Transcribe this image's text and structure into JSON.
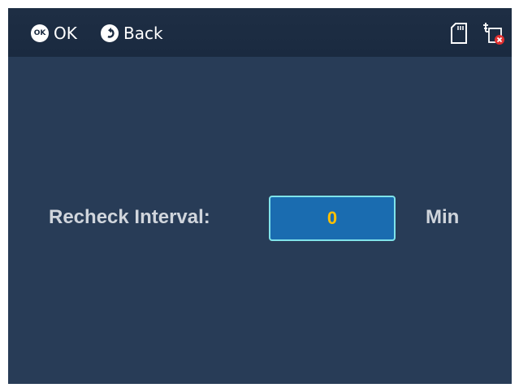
{
  "topbar": {
    "ok_icon_text": "OK",
    "ok_label": "OK",
    "back_label": "Back",
    "icons": [
      "ok-button-icon",
      "back-arrow-icon",
      "sd-card-icon",
      "network-disconnected-icon"
    ]
  },
  "form": {
    "label": "Recheck Interval:",
    "value": "0",
    "unit": "Min"
  },
  "colors": {
    "background": "#283c57",
    "topbar": "#1a2a40",
    "input_fill": "#1a6cb0",
    "input_border": "#7fe3ea",
    "value_text": "#ffc000",
    "error_badge": "#e03030"
  }
}
